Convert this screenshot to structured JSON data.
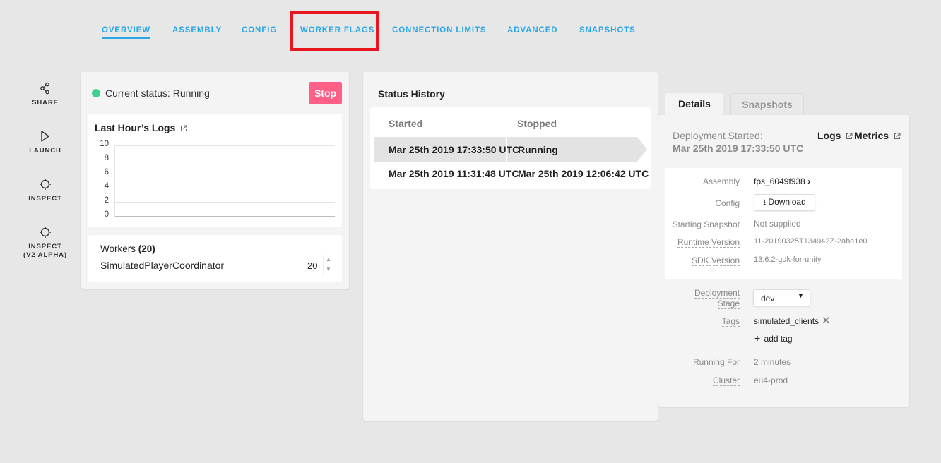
{
  "nav": {
    "tabs": [
      {
        "label": "OVERVIEW",
        "active": true
      },
      {
        "label": "ASSEMBLY"
      },
      {
        "label": "CONFIG"
      },
      {
        "label": "WORKER FLAGS",
        "highlighted": true
      },
      {
        "label": "CONNECTION LIMITS"
      },
      {
        "label": "ADVANCED"
      },
      {
        "label": "SNAPSHOTS"
      }
    ],
    "highlight_color": "#e8161f",
    "accent": "#2aa7e4"
  },
  "sidebar": {
    "items": [
      {
        "label": "SHARE",
        "icon": "share-icon"
      },
      {
        "label": "LAUNCH",
        "icon": "play-icon"
      },
      {
        "label": "INSPECT",
        "icon": "crosshair-icon"
      },
      {
        "label": "INSPECT",
        "label2": "(V2 ALPHA)",
        "icon": "crosshair-icon"
      }
    ]
  },
  "status": {
    "text": "Current status: Running",
    "dot_color": "#3fd08c",
    "stop_label": "Stop",
    "stop_color": "#ff5f87"
  },
  "logs": {
    "title": "Last Hour’s Logs",
    "yticks": [
      "10",
      "8",
      "6",
      "4",
      "2",
      "0"
    ]
  },
  "chart_data": {
    "type": "line",
    "title": "Last Hour’s Logs",
    "xlabel": "",
    "ylabel": "",
    "ylim": [
      0,
      10
    ],
    "yticks": [
      0,
      2,
      4,
      6,
      8,
      10
    ],
    "series": [],
    "grid": true
  },
  "workers": {
    "label": "Workers",
    "total": "(20)",
    "items": [
      {
        "name": "SimulatedPlayerCoordinator",
        "count": "20"
      }
    ]
  },
  "history": {
    "title": "Status History",
    "col_started": "Started",
    "col_stopped": "Stopped",
    "rows": [
      {
        "started": "Mar 25th 2019 17:33:50 UTC",
        "stopped": "Running"
      },
      {
        "started": "Mar 25th 2019 11:31:48 UTC",
        "stopped": "Mar 25th 2019 12:06:42 UTC"
      }
    ]
  },
  "details": {
    "tab_details": "Details",
    "tab_snapshots": "Snapshots",
    "started_label": "Deployment Started:",
    "started_value": "Mar 25th 2019 17:33:50 UTC",
    "logs_link": "Logs",
    "metrics_link": "Metrics",
    "assembly_label": "Assembly",
    "assembly_value": "fps_6049f938",
    "config_label": "Config",
    "download_label": "Download",
    "snapshot_label": "Starting Snapshot",
    "snapshot_value": "Not supplied",
    "runtime_label": "Runtime Version",
    "runtime_value": "11-20190325T134942Z-2abe1e0",
    "sdk_label": "SDK Version",
    "sdk_value": "13.6.2-gdk-for-unity",
    "stage_label_1": "Deployment",
    "stage_label_2": "Stage",
    "stage_value": "dev",
    "tags_label": "Tags",
    "tag_value": "simulated_clients",
    "add_tag": "add tag",
    "running_label": "Running For",
    "running_value": "2 minutes",
    "cluster_label": "Cluster",
    "cluster_value": "eu4-prod"
  }
}
